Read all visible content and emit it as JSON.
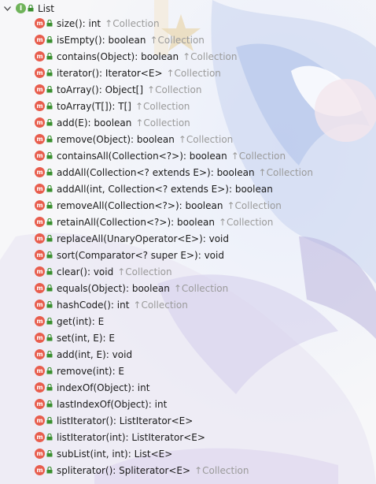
{
  "root": {
    "label": "List",
    "icon": "interface-icon"
  },
  "inherited_marker": "↑",
  "methods": [
    {
      "signature": "size(): int",
      "from": "Collection"
    },
    {
      "signature": "isEmpty(): boolean",
      "from": "Collection"
    },
    {
      "signature": "contains(Object): boolean",
      "from": "Collection"
    },
    {
      "signature": "iterator(): Iterator<E>",
      "from": "Collection"
    },
    {
      "signature": "toArray(): Object[]",
      "from": "Collection"
    },
    {
      "signature": "toArray(T[]): T[]",
      "from": "Collection"
    },
    {
      "signature": "add(E): boolean",
      "from": "Collection"
    },
    {
      "signature": "remove(Object): boolean",
      "from": "Collection"
    },
    {
      "signature": "containsAll(Collection<?>): boolean",
      "from": "Collection"
    },
    {
      "signature": "addAll(Collection<? extends E>): boolean",
      "from": "Collection"
    },
    {
      "signature": "addAll(int, Collection<? extends E>): boolean",
      "from": ""
    },
    {
      "signature": "removeAll(Collection<?>): boolean",
      "from": "Collection"
    },
    {
      "signature": "retainAll(Collection<?>): boolean",
      "from": "Collection"
    },
    {
      "signature": "replaceAll(UnaryOperator<E>): void",
      "from": ""
    },
    {
      "signature": "sort(Comparator<? super E>): void",
      "from": ""
    },
    {
      "signature": "clear(): void",
      "from": "Collection"
    },
    {
      "signature": "equals(Object): boolean",
      "from": "Collection"
    },
    {
      "signature": "hashCode(): int",
      "from": "Collection"
    },
    {
      "signature": "get(int): E",
      "from": ""
    },
    {
      "signature": "set(int, E): E",
      "from": ""
    },
    {
      "signature": "add(int, E): void",
      "from": ""
    },
    {
      "signature": "remove(int): E",
      "from": ""
    },
    {
      "signature": "indexOf(Object): int",
      "from": ""
    },
    {
      "signature": "lastIndexOf(Object): int",
      "from": ""
    },
    {
      "signature": "listIterator(): ListIterator<E>",
      "from": ""
    },
    {
      "signature": "listIterator(int): ListIterator<E>",
      "from": ""
    },
    {
      "signature": "subList(int, int): List<E>",
      "from": ""
    },
    {
      "signature": "spliterator(): Spliterator<E>",
      "from": "Collection"
    }
  ],
  "colors": {
    "method_icon": "#e85d4d",
    "interface_icon": "#6fb35a",
    "lock": "#3a8f2f",
    "inherited_text": "#9a9a9a"
  }
}
